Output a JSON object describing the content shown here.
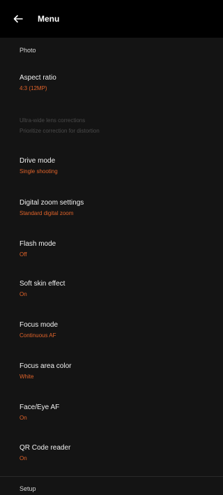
{
  "header": {
    "back_icon": "arrow-left-icon",
    "title": "Menu"
  },
  "sections": {
    "photo": "Photo",
    "setup": "Setup"
  },
  "items": [
    {
      "label": "Aspect ratio",
      "value": "4:3 (12MP)"
    },
    {
      "label": "Ultra-wide lens corrections",
      "value": "Prioritize correction for distortion"
    },
    {
      "label": "Drive mode",
      "value": "Single shooting"
    },
    {
      "label": "Digital zoom settings",
      "value": "Standard digital zoom"
    },
    {
      "label": "Flash mode",
      "value": "Off"
    },
    {
      "label": "Soft skin effect",
      "value": "On"
    },
    {
      "label": "Focus mode",
      "value": "Continuous AF"
    },
    {
      "label": "Focus area color",
      "value": "White"
    },
    {
      "label": "Face/Eye AF",
      "value": "On"
    },
    {
      "label": "QR Code reader",
      "value": "On"
    }
  ],
  "colors": {
    "accent": "#e0632a",
    "background": "#141414",
    "appbar": "#000000",
    "disabled": "#4a4a4a"
  }
}
